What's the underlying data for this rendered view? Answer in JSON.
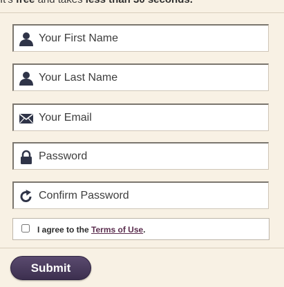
{
  "intro": {
    "prefix": "It's ",
    "free": "free",
    "middle": " and takes ",
    "duration": "less than 30 seconds."
  },
  "fields": {
    "first_name": {
      "placeholder": "Your First Name",
      "icon": "user-icon"
    },
    "last_name": {
      "placeholder": "Your Last Name",
      "icon": "user-icon"
    },
    "email": {
      "placeholder": "Your Email",
      "icon": "envelope-icon"
    },
    "password": {
      "placeholder": "Password",
      "icon": "lock-icon"
    },
    "confirm_password": {
      "placeholder": "Confirm Password",
      "icon": "refresh-icon"
    }
  },
  "agreement": {
    "prefix": "I agree to the ",
    "link": "Terms of Use",
    "suffix": ".",
    "checked": false
  },
  "submit": {
    "label": "Submit"
  },
  "colors": {
    "background": "#f8f1e4",
    "icon": "#2f3448",
    "link": "#5a2c4d",
    "button": "#45385a"
  }
}
